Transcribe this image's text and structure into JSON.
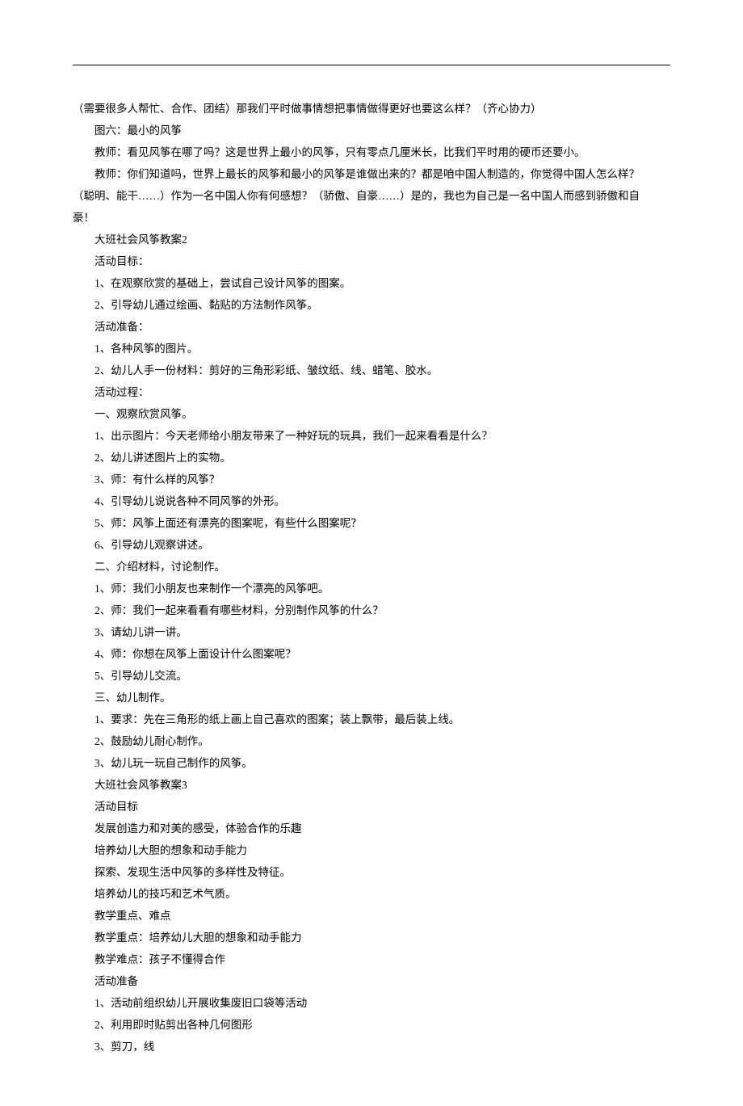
{
  "lines": [
    {
      "indent": 0,
      "text": "（需要很多人帮忙、合作、团结）那我们平时做事情想把事情做得更好也要这么样？（齐心协力）"
    },
    {
      "indent": 1,
      "text": "图六：最小的风筝"
    },
    {
      "indent": 1,
      "text": "教师：看见风筝在哪了吗？这是世界上最小的风筝，只有零点几厘米长，比我们平时用的硬币还要小。"
    },
    {
      "indent": 1,
      "text": "教师：你们知道吗，世界上最长的风筝和最小的风筝是谁做出来的？都是咱中国人制造的，你觉得中国人怎么样？"
    },
    {
      "indent": 0,
      "text": "（聪明、能干……）作为一名中国人你有何感想？（骄傲、自豪……）是的，我也为自己是一名中国人而感到骄傲和自"
    },
    {
      "indent": 0,
      "text": "豪！"
    },
    {
      "indent": 1,
      "text": "大班社会风筝教案2"
    },
    {
      "indent": 1,
      "text": "活动目标："
    },
    {
      "indent": 1,
      "text": "1、在观察欣赏的基础上，尝试自己设计风筝的图案。"
    },
    {
      "indent": 1,
      "text": "2、引导幼儿通过绘画、黏贴的方法制作风筝。"
    },
    {
      "indent": 1,
      "text": "活动准备："
    },
    {
      "indent": 1,
      "text": "1、各种风筝的图片。"
    },
    {
      "indent": 1,
      "text": "2、幼儿人手一份材料：剪好的三角形彩纸、皱纹纸、线、蜡笔、胶水。"
    },
    {
      "indent": 1,
      "text": "活动过程："
    },
    {
      "indent": 1,
      "text": "一、观察欣赏风筝。"
    },
    {
      "indent": 1,
      "text": "1、出示图片：今天老师给小朋友带来了一种好玩的玩具，我们一起来看看是什么？"
    },
    {
      "indent": 1,
      "text": "2、幼儿讲述图片上的实物。"
    },
    {
      "indent": 1,
      "text": "3、师：有什么样的风筝？"
    },
    {
      "indent": 1,
      "text": "4、引导幼儿说说各种不同风筝的外形。"
    },
    {
      "indent": 1,
      "text": "5、师：风筝上面还有漂亮的图案呢，有些什么图案呢？"
    },
    {
      "indent": 1,
      "text": "6、引导幼儿观察讲述。"
    },
    {
      "indent": 1,
      "text": "二、介绍材料，讨论制作。"
    },
    {
      "indent": 1,
      "text": "1、师：我们小朋友也来制作一个漂亮的风筝吧。"
    },
    {
      "indent": 1,
      "text": "2、师：我们一起来看看有哪些材料，分别制作风筝的什么？"
    },
    {
      "indent": 1,
      "text": "3、请幼儿讲一讲。"
    },
    {
      "indent": 1,
      "text": "4、师：你想在风筝上面设计什么图案呢？"
    },
    {
      "indent": 1,
      "text": "5、引导幼儿交流。"
    },
    {
      "indent": 1,
      "text": "三、幼儿制作。"
    },
    {
      "indent": 1,
      "text": "1、要求：先在三角形的纸上画上自己喜欢的图案；装上飘带，最后装上线。"
    },
    {
      "indent": 1,
      "text": "2、鼓励幼儿耐心制作。"
    },
    {
      "indent": 1,
      "text": "3、幼儿玩一玩自己制作的风筝。"
    },
    {
      "indent": 1,
      "text": "大班社会风筝教案3"
    },
    {
      "indent": 1,
      "text": "活动目标"
    },
    {
      "indent": 1,
      "text": "发展创造力和对美的感受，体验合作的乐趣"
    },
    {
      "indent": 1,
      "text": "培养幼儿大胆的想象和动手能力"
    },
    {
      "indent": 1,
      "text": "探索、发现生活中风筝的多样性及特征。"
    },
    {
      "indent": 1,
      "text": "培养幼儿的技巧和艺术气质。"
    },
    {
      "indent": 1,
      "text": "教学重点、难点"
    },
    {
      "indent": 1,
      "text": "教学重点：培养幼儿大胆的想象和动手能力"
    },
    {
      "indent": 1,
      "text": "教学难点：孩子不懂得合作"
    },
    {
      "indent": 1,
      "text": "活动准备"
    },
    {
      "indent": 1,
      "text": "1、活动前组织幼儿开展收集废旧口袋等活动"
    },
    {
      "indent": 1,
      "text": "2、利用即时贴剪出各种几何图形"
    },
    {
      "indent": 1,
      "text": "3、剪刀，线"
    }
  ]
}
